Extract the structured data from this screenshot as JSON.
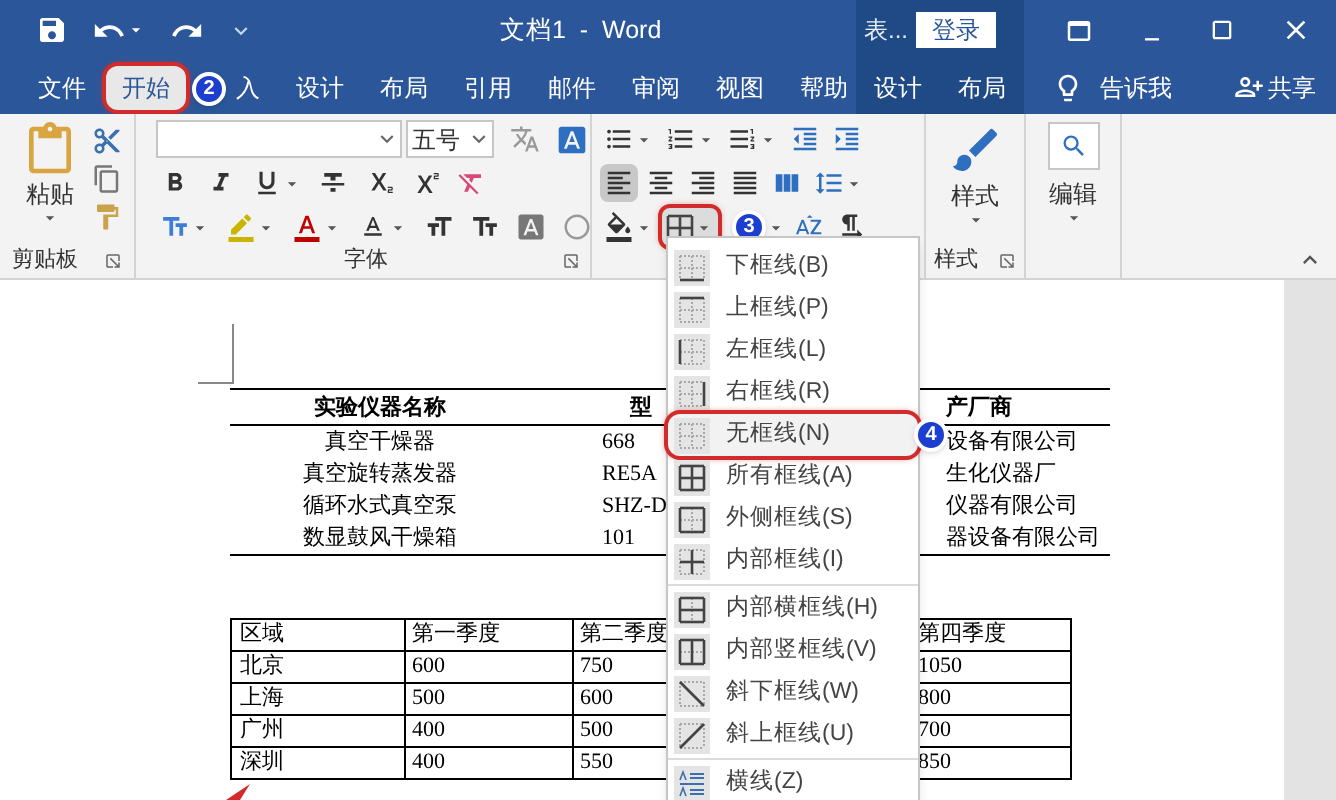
{
  "title_bar": {
    "title": "文档1  -  Word",
    "context_group": "表...",
    "login_button": "登录"
  },
  "tabs": [
    {
      "label": "文件",
      "selected": false,
      "circled": false,
      "contextual": false
    },
    {
      "label": "开始",
      "selected": true,
      "circled": true,
      "contextual": false
    },
    {
      "label": "入",
      "selected": false,
      "circled": false,
      "contextual": false,
      "badge": "2"
    },
    {
      "label": "设计",
      "selected": false,
      "circled": false,
      "contextual": false
    },
    {
      "label": "布局",
      "selected": false,
      "circled": false,
      "contextual": false
    },
    {
      "label": "引用",
      "selected": false,
      "circled": false,
      "contextual": false
    },
    {
      "label": "邮件",
      "selected": false,
      "circled": false,
      "contextual": false
    },
    {
      "label": "审阅",
      "selected": false,
      "circled": false,
      "contextual": false
    },
    {
      "label": "视图",
      "selected": false,
      "circled": false,
      "contextual": false
    },
    {
      "label": "帮助",
      "selected": false,
      "circled": false,
      "contextual": false
    },
    {
      "label": "设计",
      "selected": false,
      "circled": false,
      "contextual": true
    },
    {
      "label": "布局",
      "selected": false,
      "circled": false,
      "contextual": true
    }
  ],
  "tell_me": "告诉我",
  "share": "共享",
  "ribbon": {
    "clipboard": {
      "paste": "粘贴",
      "label": "剪贴板"
    },
    "font": {
      "size": "五号",
      "label": "字体",
      "rows": [
        [
          {
            "kind": "bold"
          },
          {
            "kind": "italic"
          },
          {
            "kind": "underline"
          },
          {
            "kind": "strike"
          },
          {
            "kind": "subscript"
          },
          {
            "kind": "superscript"
          },
          {
            "kind": "clear"
          }
        ],
        [
          {
            "kind": "effects"
          },
          {
            "kind": "highlight"
          },
          {
            "kind": "color"
          },
          {
            "kind": "case"
          },
          {
            "kind": "grow"
          },
          {
            "kind": "shrink"
          },
          {
            "kind": "shading"
          },
          {
            "kind": "enclose"
          }
        ]
      ]
    },
    "paragraph": {
      "rows": [
        [
          {
            "kind": "bullets"
          },
          {
            "kind": "numbering"
          },
          {
            "kind": "multilevel"
          },
          {
            "kind": "outdent"
          },
          {
            "kind": "indent"
          }
        ],
        [
          {
            "kind": "align_left",
            "selected": true
          },
          {
            "kind": "align_center",
            "selected": false
          },
          {
            "kind": "align_right",
            "selected": false
          },
          {
            "kind": "justify",
            "selected": false
          },
          {
            "kind": "distributed",
            "selected": false
          },
          {
            "kind": "line_spacing",
            "selected": false
          }
        ],
        [
          {
            "kind": "para_shading",
            "circled": false
          },
          {
            "kind": "borders",
            "circled": true,
            "badge": "3"
          },
          {
            "kind": "sort",
            "circled": false
          },
          {
            "kind": "marks",
            "circled": false
          }
        ]
      ]
    },
    "styles": {
      "button": "样式",
      "label": "样式"
    },
    "editing": {
      "button": "编辑"
    }
  },
  "document": {
    "table1": {
      "columns": [
        "实验仪器名称",
        "型",
        "产厂商"
      ],
      "rows": [
        [
          "真空干燥器",
          "668",
          "设备有限公司"
        ],
        [
          "真空旋转蒸发器",
          "RE5A",
          "生化仪器厂"
        ],
        [
          "循环水式真空泵",
          "SHZ-D",
          "仪器有限公司"
        ],
        [
          "数显鼓风干燥箱",
          "101",
          "器设备有限公司"
        ]
      ]
    },
    "table2": {
      "columns": [
        "区域",
        "第一季度",
        "第二季度",
        "第四季度"
      ],
      "rows": [
        [
          "北京",
          "600",
          "750",
          "1050"
        ],
        [
          "上海",
          "500",
          "600",
          "800"
        ],
        [
          "广州",
          "400",
          "500",
          "700"
        ],
        [
          "深圳",
          "400",
          "550",
          "850"
        ]
      ]
    }
  },
  "border_menu": {
    "groups": [
      [
        {
          "kind": "bottom",
          "label": "下框线(B)",
          "circled": false
        },
        {
          "kind": "top",
          "label": "上框线(P)",
          "circled": false
        },
        {
          "kind": "left",
          "label": "左框线(L)",
          "circled": false
        },
        {
          "kind": "right",
          "label": "右框线(R)",
          "circled": false
        },
        {
          "kind": "none",
          "label": "无框线(N)",
          "circled": true,
          "badge": "4"
        },
        {
          "kind": "all",
          "label": "所有框线(A)",
          "circled": false
        },
        {
          "kind": "outside",
          "label": "外侧框线(S)",
          "circled": false
        },
        {
          "kind": "inside",
          "label": "内部框线(I)",
          "circled": false
        }
      ],
      [
        {
          "kind": "inside_h",
          "label": "内部横框线(H)",
          "circled": false
        },
        {
          "kind": "inside_v",
          "label": "内部竖框线(V)",
          "circled": false
        },
        {
          "kind": "diag_down",
          "label": "斜下框线(W)",
          "circled": false
        },
        {
          "kind": "diag_up",
          "label": "斜上框线(U)",
          "circled": false
        }
      ],
      [
        {
          "kind": "hline",
          "label": "横线(Z)",
          "circled": false
        }
      ]
    ]
  }
}
